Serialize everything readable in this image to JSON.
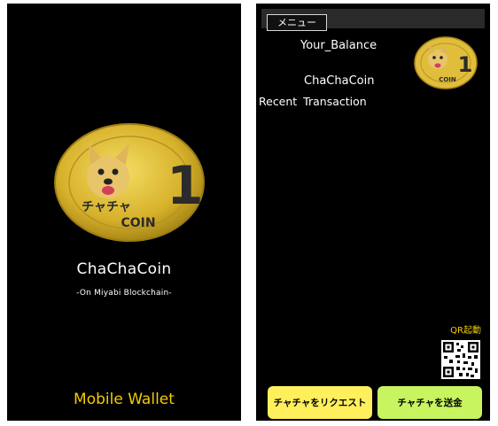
{
  "splash": {
    "title": "ChaChaCoin",
    "subtitle": "-On Miyabi Blockchain-",
    "footer": "Mobile Wallet",
    "coin_icon": "chachacoin-logo"
  },
  "wallet": {
    "menu_button": "メニュー",
    "balance_label": "Your_Balance",
    "coin_name": "ChaChaCoin",
    "recent_label": "Recent Transaction",
    "qr_label": "QR起動",
    "qr_icon": "qr-code-icon",
    "request_button": "チャチャをリクエスト",
    "send_button": "チャチャを送金"
  },
  "colors": {
    "background": "#000000",
    "accent_text": "#f2cc00",
    "coin_gold": "#d9b52c",
    "request_button": "#ffef5c",
    "send_button": "#c7f45f"
  }
}
